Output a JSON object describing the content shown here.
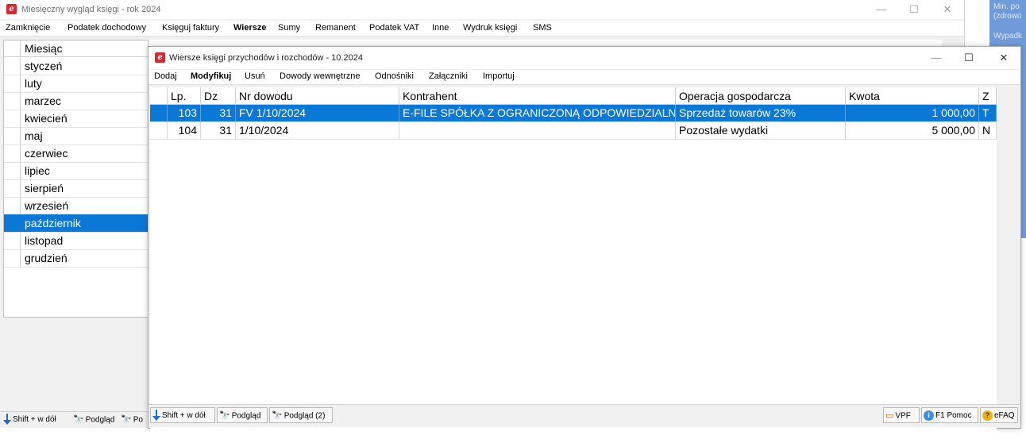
{
  "back_window": {
    "title": "Miesięczny wygląd księgi - rok 2024",
    "app_icon": "e",
    "controls": {
      "minimize": "—",
      "maximize": "☐",
      "close": "✕"
    },
    "menu": [
      "Zamknięcie",
      "Podatek dochodowy",
      "Księguj faktury",
      "Wiersze",
      "Sumy",
      "Remanent",
      "Podatek VAT",
      "Inne",
      "Wydruk księgi",
      "SMS"
    ],
    "month_header": "Miesiąc",
    "months": [
      "styczeń",
      "luty",
      "marzec",
      "kwiecień",
      "maj",
      "czerwiec",
      "lipiec",
      "sierpień",
      "wrzesień",
      "październik",
      "listopad",
      "grudzień"
    ],
    "selected_month_index": 9,
    "toolbar": {
      "shift_down": "Shift + w dół",
      "preview": "Podgląd",
      "preview_partial": "Po"
    }
  },
  "side_panel": {
    "line1": "Min. po",
    "line2": "(zdrowo",
    "line3": "Wypadk",
    "color": "#6f9bd9"
  },
  "front_window": {
    "title": "Wiersze księgi przychodów i rozchodów - 10.2024",
    "app_icon": "e",
    "controls": {
      "minimize": "—",
      "maximize": "☐",
      "close": "✕"
    },
    "menu": [
      "Dodaj",
      "Modyfikuj",
      "Usuń",
      "Dowody wewnętrzne",
      "Odnośniki",
      "Załączniki",
      "Importuj"
    ],
    "columns": [
      "Lp.",
      "Dz",
      "Nr dowodu",
      "Kontrahent",
      "Operacja gospodarcza",
      "Kwota",
      "Z"
    ],
    "rows": [
      {
        "lp": "103",
        "dz": "31",
        "nr": "FV 1/10/2024",
        "kontrahent": "E-FILE SPÓŁKA Z OGRANICZONĄ ODPOWIEDZIALNOŚCIĄ",
        "operacja": "Sprzedaż towarów 23%",
        "kwota": "1 000,00",
        "z": "T"
      },
      {
        "lp": "104",
        "dz": "31",
        "nr": "1/10/2024",
        "kontrahent": "",
        "operacja": "Pozostałe wydatki",
        "kwota": "5 000,00",
        "z": "N"
      }
    ],
    "selected_row_index": 0,
    "toolbar": {
      "shift_down": "Shift + w dół",
      "preview": "Podgląd",
      "preview2": "Podgląd (2)",
      "vpf": "VPF",
      "help": "F1 Pomoc",
      "efaq": "eFAQ"
    }
  },
  "colors": {
    "selection": "#0a78d7",
    "brand_red": "#d9262b"
  }
}
